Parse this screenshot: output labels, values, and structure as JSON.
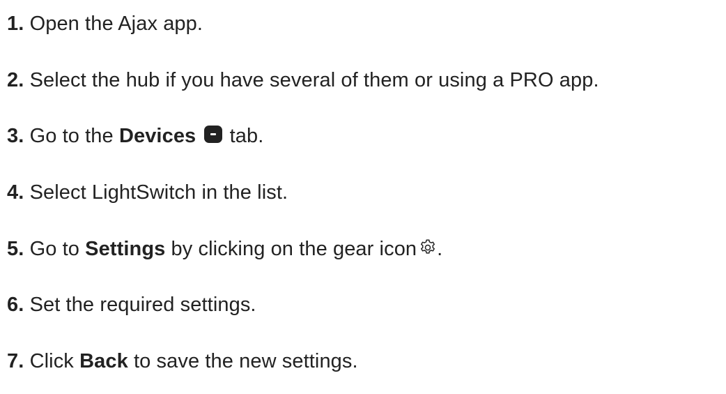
{
  "steps": [
    {
      "number": "1.",
      "text": "Open the Ajax app."
    },
    {
      "number": "2.",
      "text": "Select the hub if you have several of them or using a PRO app."
    },
    {
      "number": "3.",
      "pre": "Go to the",
      "bold": "Devices",
      "post": "tab.",
      "icon": "devices-tab-icon"
    },
    {
      "number": "4.",
      "text": "Select LightSwitch in the list."
    },
    {
      "number": "5.",
      "pre": "Go to",
      "bold": "Settings",
      "post": "by clicking on the gear icon",
      "end": ".",
      "icon": "gear-icon"
    },
    {
      "number": "6.",
      "text": "Set the required settings."
    },
    {
      "number": "7.",
      "pre": "Click",
      "bold": "Back",
      "post": "to save the new settings."
    }
  ],
  "colors": {
    "text": "#222222",
    "background": "#ffffff"
  }
}
